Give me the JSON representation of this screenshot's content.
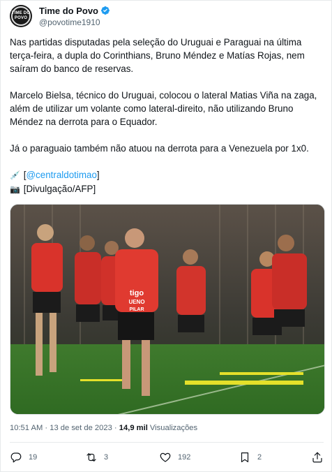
{
  "author": {
    "display_name": "Time do Povo",
    "handle": "@povotime1910",
    "avatar_text": "TIME DO POVO",
    "verified_color": "#1d9bf0"
  },
  "post": {
    "paragraph_1": "Nas partidas disputadas pela seleção do Uruguai e Paraguai na última terça-feira, a dupla do Corinthians, Bruno Méndez e Matías Rojas, nem saíram do banco de reservas.",
    "paragraph_2": "Marcelo Bielsa, técnico do Uruguai, colocou o lateral Matias Viña na zaga, além de utilizar um volante como lateral-direito, não utilizando Bruno Méndez na derrota para o Equador.",
    "paragraph_3": "Já o paraguaio também não atuou na derrota para a Venezuela por 1x0.",
    "credit_1_emoji": "💉",
    "credit_1_open": "[",
    "credit_1_link": "@centraldotimao",
    "credit_1_close": "]",
    "credit_2_emoji": "📷",
    "credit_2_text": "[Divulgação/AFP]"
  },
  "photo": {
    "jersey_text_1": "tigo",
    "jersey_text_2": "UENO",
    "jersey_text_3": "PILAR"
  },
  "meta": {
    "time": "10:51 AM",
    "separator": "·",
    "date": "13 de set de 2023",
    "views_count": "14,9 mil",
    "views_label": "Visualizações"
  },
  "actions": {
    "replies": "19",
    "reposts": "3",
    "likes": "192",
    "bookmarks": "2"
  },
  "colors": {
    "accent": "#1d9bf0",
    "secondary_text": "#536471",
    "jersey_red": "#d9332b",
    "pitch_green": "#3f7a2d"
  }
}
